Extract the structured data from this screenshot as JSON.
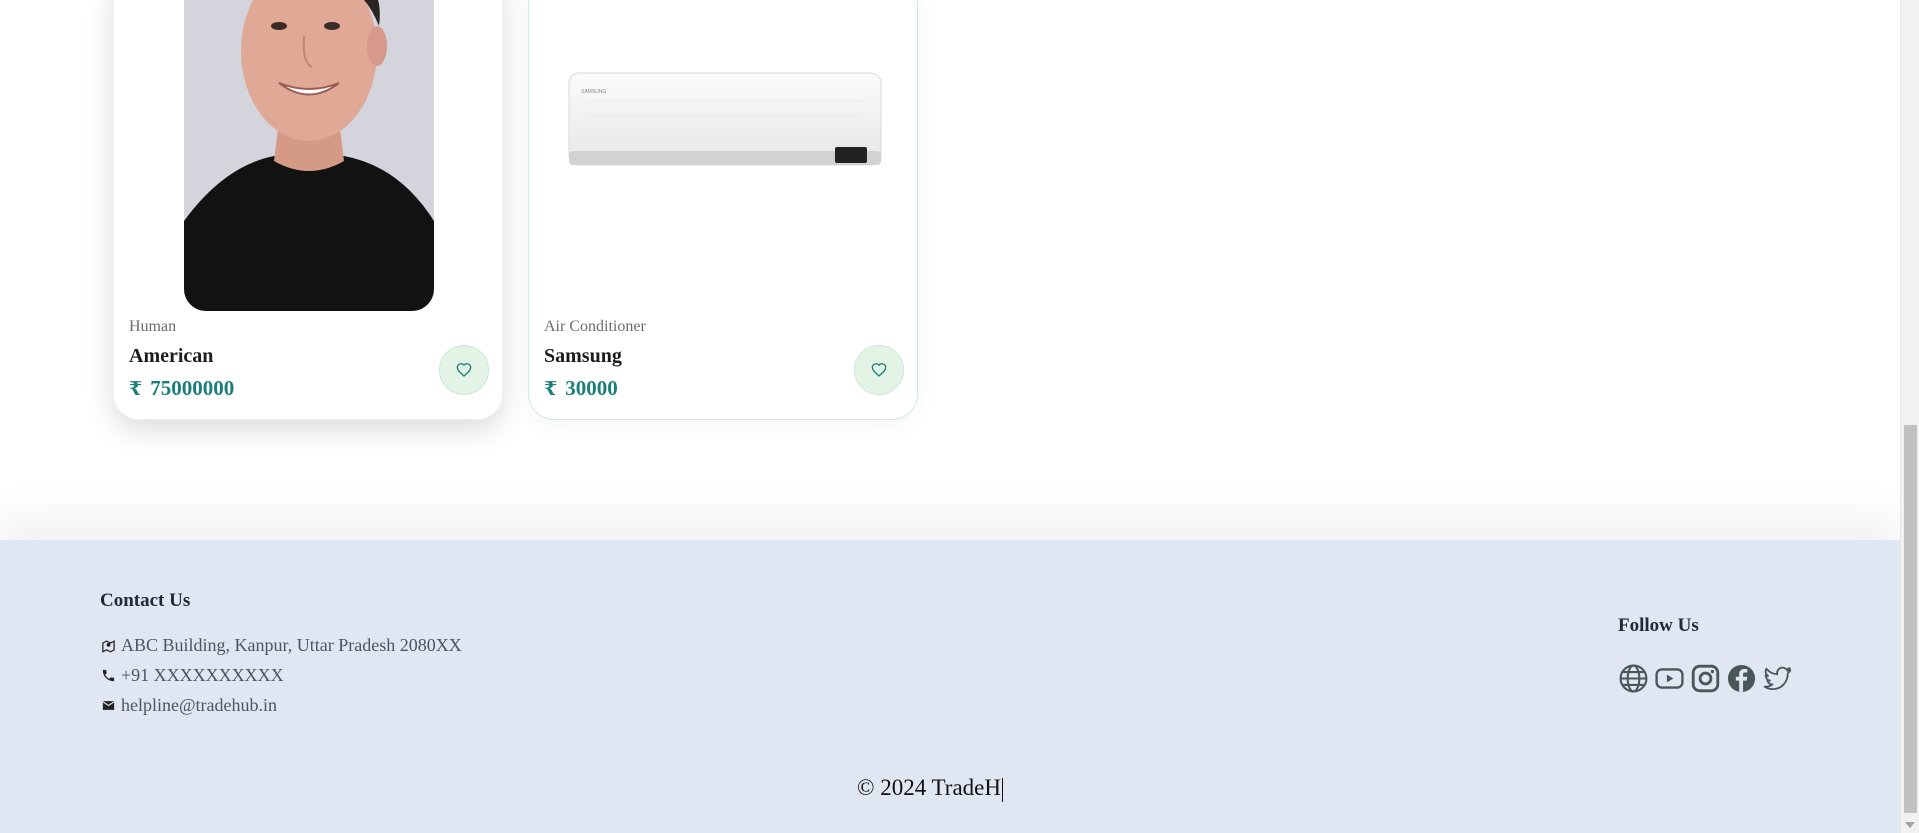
{
  "products": [
    {
      "category": "Human",
      "title": "American",
      "currency_symbol": "₹",
      "price": "75000000",
      "image_icon": "person-photo"
    },
    {
      "category": "Air Conditioner",
      "title": "Samsung",
      "currency_symbol": "₹",
      "price": "30000",
      "image_icon": "air-conditioner-photo"
    }
  ],
  "footer": {
    "contact_heading": "Contact Us",
    "address": "ABC Building, Kanpur, Uttar Pradesh 2080XX",
    "phone": "+91 XXXXXXXXXX",
    "email": "helpline@tradehub.in",
    "follow_heading": "Follow Us",
    "social_icons": [
      "globe-icon",
      "youtube-icon",
      "instagram-icon",
      "facebook-icon",
      "twitter-icon"
    ],
    "copyright": "© 2024 TradeH"
  },
  "colors": {
    "accent": "#1b7f79",
    "footer_bg": "#e1e6f3",
    "fav_bg": "#e3f4e7"
  }
}
